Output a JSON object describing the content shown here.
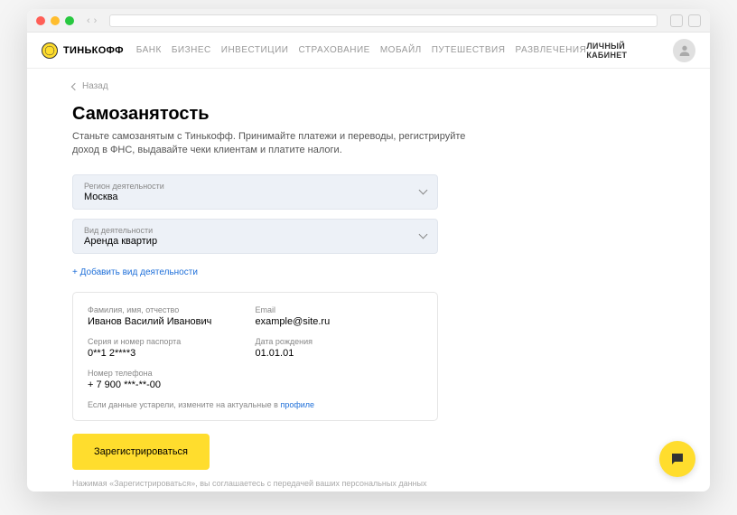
{
  "brand": "ТИНЬКОФФ",
  "nav": {
    "items": [
      "БАНК",
      "БИЗНЕС",
      "ИНВЕСТИЦИИ",
      "СТРАХОВАНИЕ",
      "МОБАЙЛ",
      "ПУТЕШЕСТВИЯ",
      "РАЗВЛЕЧЕНИЯ"
    ],
    "account": "ЛИЧНЫЙ КАБИНЕТ"
  },
  "back": "Назад",
  "title": "Самозанятость",
  "subtitle": "Станьте самозанятым с Тинькофф. Принимайте платежи и переводы, регистрируйте доход в ФНС, выдавайте чеки клиентам и платите налоги.",
  "region": {
    "label": "Регион деятельности",
    "value": "Москва"
  },
  "activity": {
    "label": "Вид деятельности",
    "value": "Аренда квартир"
  },
  "add_activity": "+  Добавить вид деятельности",
  "info": {
    "name": {
      "label": "Фамилия, имя, отчество",
      "value": "Иванов Василий Иванович"
    },
    "email": {
      "label": "Email",
      "value": "example@site.ru"
    },
    "passport": {
      "label": "Серия и номер паспорта",
      "value": "0**1 2****3"
    },
    "dob": {
      "label": "Дата рождения",
      "value": "01.01.01"
    },
    "phone": {
      "label": "Номер телефона",
      "value": "+ 7 900 ***-**-00"
    },
    "note_prefix": "Если данные устарели, измените на актуальные в ",
    "note_link": "профиле"
  },
  "submit": "Зарегистрироваться",
  "legal": "Нажимая «Зарегистрироваться», вы соглашаетесь с передачей ваших персональных данных"
}
